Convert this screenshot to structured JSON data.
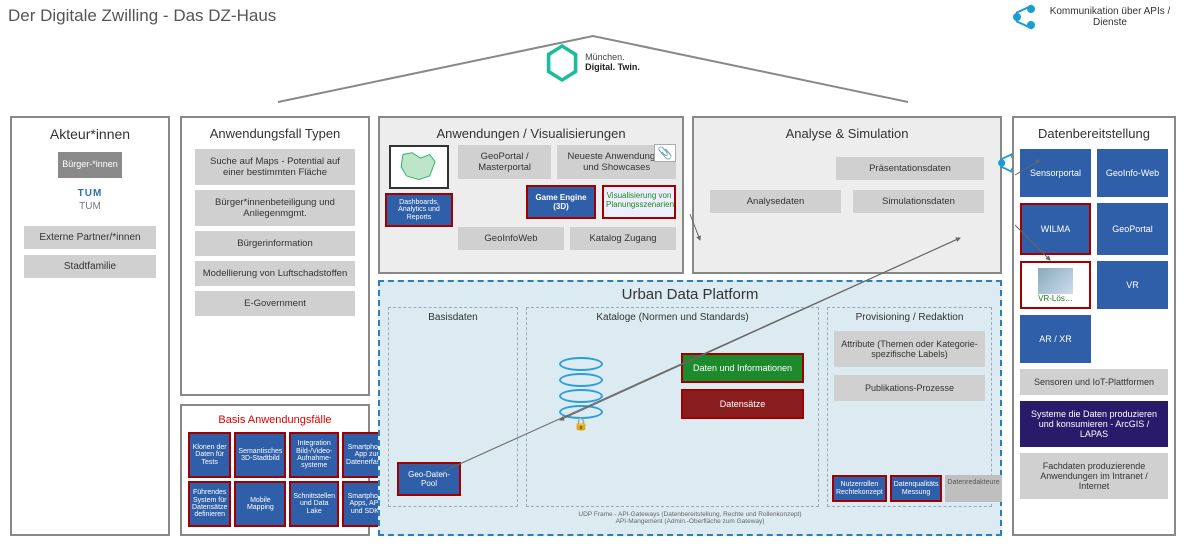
{
  "title": "Der Digitale Zwilling - Das DZ-Haus",
  "api_legend": "Kommunikation über APIs / Dienste",
  "logo": {
    "l1": "München.",
    "l2": "Digital. Twin."
  },
  "actors": {
    "title": "Akteur*innen",
    "citizens": "Bürger-*innen",
    "tum_logo": "TUM",
    "tum_label": "TUM",
    "external": "Externe Partner/*innen",
    "city": "Stadtfamilie"
  },
  "usecases": {
    "title": "Anwendungsfall Typen",
    "items": [
      "Suche auf Maps - Potential auf einer bestimmten Fläche",
      "Bürger*innenbeteiligung und Anliegenmgmt.",
      "Bürgerinformation",
      "Modellierung von Luftschadstoffen",
      "E-Government"
    ]
  },
  "basecases": {
    "title": "Basis Anwendungsfälle",
    "items": [
      "Klonen der Daten für Tests",
      "Semantisches 3D-Stadtbild",
      "Integration Bild-/Video-Aufnahme-systeme",
      "Smartphone App zur Datenerfas…",
      "Führendes System für Datensätze definieren",
      "Mobile Mapping",
      "Schnittstellen und Data Lake",
      "Smartphone Apps, APIs und SDKs"
    ]
  },
  "apps": {
    "title": "Anwendungen / Visualisierungen",
    "geoportal": "GeoPortal / Masterportal",
    "newest": "Neueste Anwendungen und Showcases",
    "dashboards": "Dashboards, Analytics und Reports",
    "game": "Game Engine (3D)",
    "visual": "Visualisierung von Planungsszenarien",
    "geoinfoweb": "GeoInfoWeb",
    "catalog": "Katalog Zugang"
  },
  "analysis": {
    "title": "Analyse & Simulation",
    "presentation": "Präsentationsdaten",
    "analysis_data": "Analysedaten",
    "simulation": "Simulationsdaten"
  },
  "udp": {
    "title": "Urban Data Platform",
    "basis": "Basisdaten",
    "catalog": "Kataloge (Normen und Standards)",
    "provisioning": "Provisioning / Redaktion",
    "geo_pool": "Geo-Daten-Pool",
    "green": "Daten und Informationen",
    "red": "Datensätze",
    "attributes": "Attribute (Themen oder Kategorie-spezifische Labels)",
    "publication": "Publikations-Prozesse",
    "roles": "Nutzerrollen Rechtekonzept",
    "quality": "Datenqualitäts Messung",
    "editors": "Datenredakteure",
    "footer1": "UDP Frame - API-Gateways (Datenbereitstellung, Rechte und Rollenkonzept)",
    "footer2": "API-Mangement (Admin.-Oberfläche zum Gateway)"
  },
  "provision": {
    "title": "Datenbereitstellung",
    "sensor": "Sensorportal",
    "geoinfoweb": "GeoInfo-Web",
    "wilma": "WILMA",
    "geoportal": "GeoPortal",
    "vr_solution": "VR-Lös…",
    "vr": "VR",
    "arxr": "AR / XR",
    "iot": "Sensoren und IoT-Plattformen",
    "systems": "Systeme die Daten produzieren und konsumieren - ArcGIS / LAPAS",
    "intranet": "Fachdaten produzierende Anwendungen im Intranet / Internet"
  }
}
